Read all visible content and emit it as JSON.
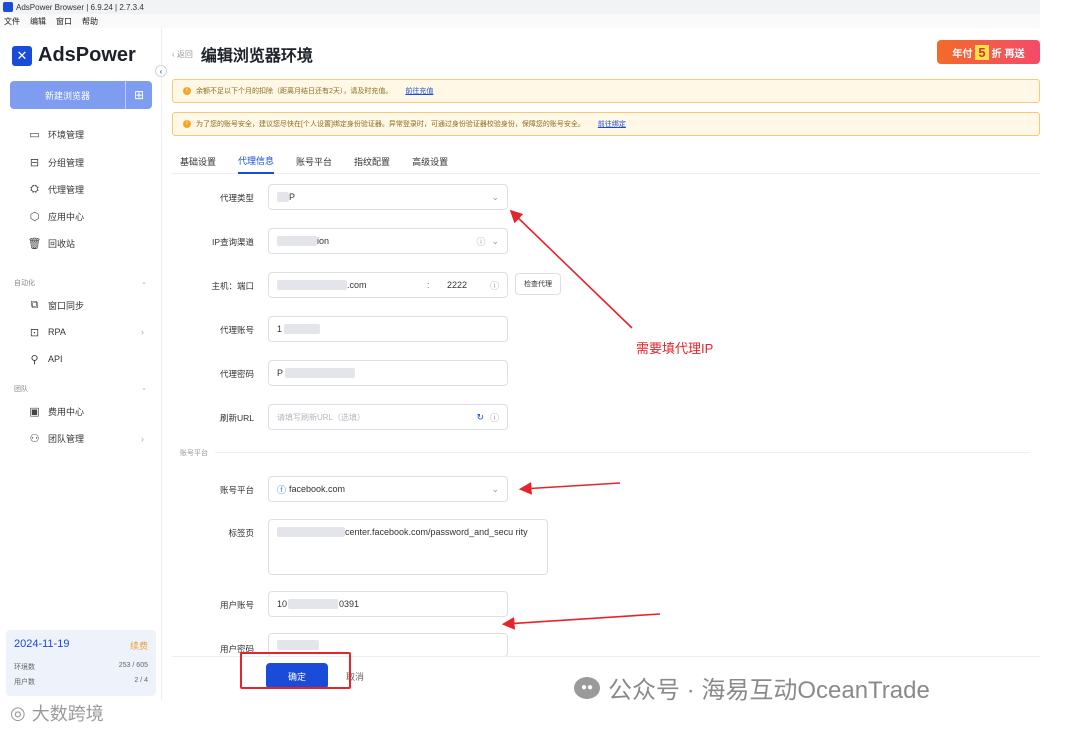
{
  "titlebar": {
    "title": "AdsPower Browser | 6.9.24 | 2.7.3.4"
  },
  "menu": [
    "文件",
    "编辑",
    "窗口",
    "帮助"
  ],
  "sidebar": {
    "brand": "AdsPower",
    "new_button": "新建浏览器",
    "items": [
      {
        "label": "环境管理",
        "icon": "folder-icon"
      },
      {
        "label": "分组管理",
        "icon": "folder-open-icon"
      },
      {
        "label": "代理管理",
        "icon": "network-icon"
      },
      {
        "label": "应用中心",
        "icon": "apps-icon"
      },
      {
        "label": "回收站",
        "icon": "trash-icon"
      }
    ],
    "section_automation": "自动化",
    "automation_items": [
      {
        "label": "窗口同步",
        "icon": "sync-icon"
      },
      {
        "label": "RPA",
        "icon": "robot-icon"
      },
      {
        "label": "API",
        "icon": "api-icon"
      }
    ],
    "section_team": "团队",
    "team_items": [
      {
        "label": "费用中心",
        "icon": "billing-icon"
      },
      {
        "label": "团队管理",
        "icon": "team-icon"
      }
    ],
    "card": {
      "date": "2024-11-19",
      "renew": "续费",
      "env_label": "环境数",
      "env_value": "253 / 605",
      "user_label": "用户数",
      "user_value": "2 / 4"
    }
  },
  "header": {
    "back": "返回",
    "title": "编辑浏览器环境"
  },
  "promo": {
    "prefix": "年付",
    "number": "5",
    "suffix": "折",
    "tag": "再送"
  },
  "notices": [
    {
      "text": "余额不足以下个月的扣除（距离月结日还有2天），请及时充值。",
      "link": "前往充值"
    },
    {
      "text": "为了您的账号安全，建议您尽快在[个人设置]绑定身份验证器。异常登录时，可通过身份验证器校验身份，保障您的账号安全。",
      "link": "前往绑定"
    }
  ],
  "tabs": [
    "基础设置",
    "代理信息",
    "账号平台",
    "指纹配置",
    "高级设置"
  ],
  "form": {
    "proxy_type_label": "代理类型",
    "proxy_type_value": "P",
    "ip_query_label": "IP查询渠道",
    "ip_query_value": "ion",
    "host_label": "主机：端口",
    "host_value": ".com",
    "port_value": "2222",
    "check_button": "检查代理",
    "proxy_account_label": "代理账号",
    "proxy_account_value": "1",
    "proxy_password_label": "代理密码",
    "proxy_password_value": "P",
    "refresh_url_label": "刷新URL",
    "refresh_url_placeholder": "请填写刷新URL（选填）",
    "platform_section": "账号平台",
    "platform_label": "账号平台",
    "platform_value": "facebook.com",
    "tab_page_label": "标签页",
    "tab_page_value": "center.facebook.com/password_and_secu rity",
    "user_account_label": "用户账号",
    "user_account_value": "10",
    "user_account_tail": "0391",
    "user_password_label": "用户密码"
  },
  "buttons": {
    "confirm": "确定",
    "cancel": "取消"
  },
  "annotation": "需要填代理IP",
  "watermarks": {
    "wechat": "公众号 · 海易互动OceanTrade",
    "corner": "大数跨境"
  },
  "colors": {
    "accent": "#1a4bd9",
    "annotation_red": "#e5252c",
    "notice_bg": "#fff8e6"
  }
}
